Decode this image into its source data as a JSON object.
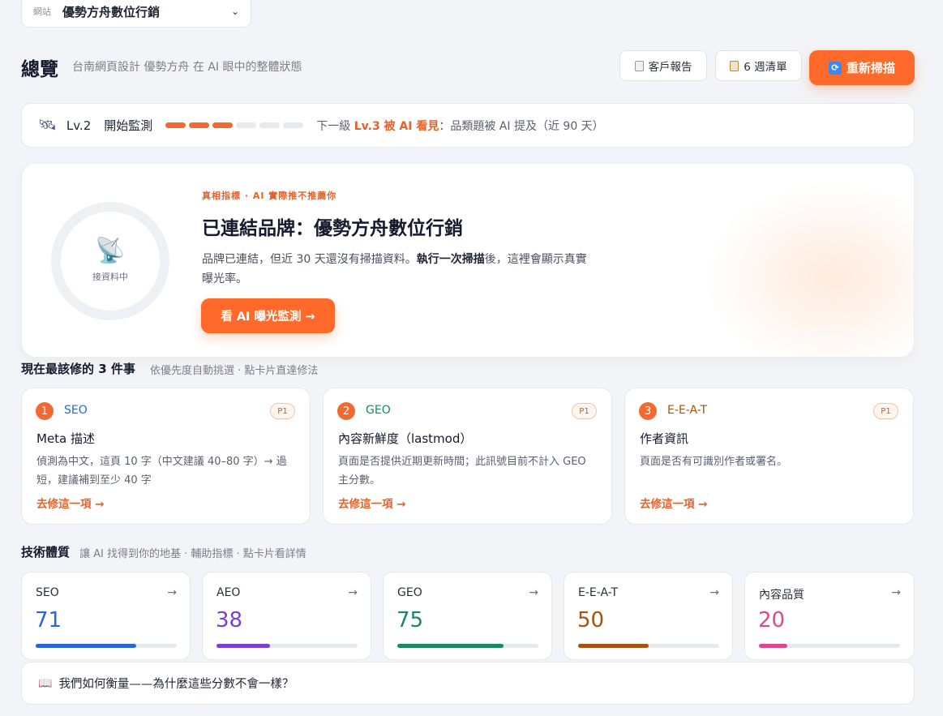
{
  "site_select": {
    "label": "網站",
    "value": "優勢方舟數位行銷"
  },
  "header": {
    "title": "總覽",
    "subtitle": "台南網頁設計 優勢方舟 在 AI 眼中的整體狀態",
    "report_label": "客戶報告",
    "checklist_label": "6 週清單",
    "rescan_label": "重新掃描"
  },
  "level": {
    "badge": "Lv.2",
    "name": "開始監測",
    "progress": {
      "filled": 3,
      "total": 6
    },
    "next_prefix": "下一級",
    "next_level": "Lv.3 被 AI 看見",
    "next_desc": "：品類題被 AI 提及（近 90 天）"
  },
  "hero": {
    "ring_label": "接資料中",
    "eyebrow": "真相指標 · AI 實際推不推薦你",
    "title": "已連結品牌：優勢方舟數位行銷",
    "desc_a": "品牌已連結，但近 30 天還沒有掃描資料。",
    "desc_b": "執行一次掃描",
    "desc_c": "後，這裡會顯示真實曝光率。",
    "button": "看 AI 曝光監測 →"
  },
  "fixes": {
    "title": "現在最該修的 3 件事",
    "subtitle": "依優先度自動挑選 · 點卡片直達修法",
    "cards": [
      {
        "num": "1",
        "category": "SEO",
        "priority": "P1",
        "name": "Meta 描述",
        "desc": "偵測為中文，這頁 10 字（中文建議 40–80 字）→ 過短，建議補到至少 40 字",
        "link": "去修這一項 →",
        "color": "#2b66d9"
      },
      {
        "num": "2",
        "category": "GEO",
        "priority": "P1",
        "name": "內容新鮮度（lastmod）",
        "desc": "頁面是否提供近期更新時間；此訊號目前不計入 GEO 主分數。",
        "link": "去修這一項 →",
        "color": "#188a5e"
      },
      {
        "num": "3",
        "category": "E-E-A-T",
        "priority": "P1",
        "name": "作者資訊",
        "desc": "頁面是否有可識別作者或署名。",
        "link": "去修這一項 →",
        "color": "#a8520f"
      }
    ]
  },
  "tech": {
    "title": "技術體質",
    "subtitle": "讓 AI 找得到你的地基 · 輔助指標 · 點卡片看詳情",
    "scores": [
      {
        "name": "SEO",
        "value": "71",
        "pct": 71,
        "color": "#2b66d9"
      },
      {
        "name": "AEO",
        "value": "38",
        "pct": 38,
        "color": "#7b3fd4"
      },
      {
        "name": "GEO",
        "value": "75",
        "pct": 75,
        "color": "#178a63"
      },
      {
        "name": "E-E-A-T",
        "value": "50",
        "pct": 50,
        "color": "#a8520f"
      },
      {
        "name": "內容品質",
        "value": "20",
        "pct": 20,
        "color": "#e0478d"
      }
    ],
    "arrow": "→"
  },
  "measure_label": "我們如何衡量——為什麼這些分數不會一樣？"
}
